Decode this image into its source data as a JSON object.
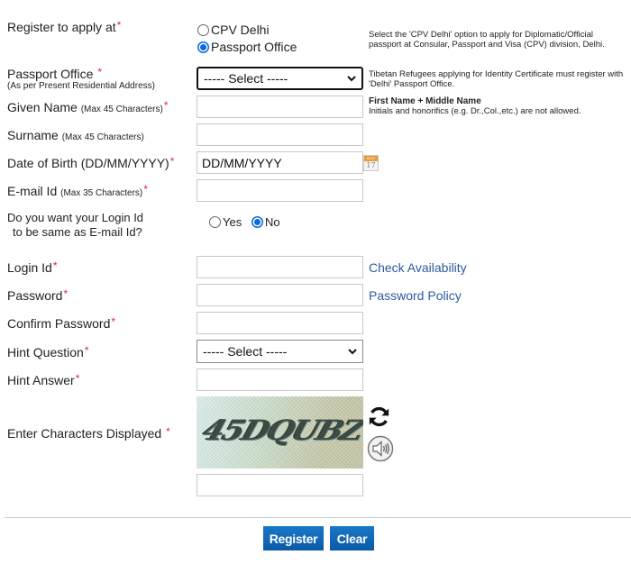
{
  "register_at": {
    "label": "Register to apply at",
    "options": [
      {
        "label": "CPV Delhi",
        "selected": false
      },
      {
        "label": "Passport Office",
        "selected": true
      }
    ],
    "hint": "Select the 'CPV Delhi' option to apply for Diplomatic/Official passport at Consular, Passport and Visa (CPV) division, Delhi."
  },
  "passport_office": {
    "label": "Passport Office",
    "sublabel": "(As per Present Residential Address)",
    "selected": "----- Select -----",
    "hint": "Tibetan Refugees applying for Identity Certificate must register with 'Delhi' Passport Office."
  },
  "given_name": {
    "label": "Given Name",
    "note": "(Max 45 Characters)",
    "value": "",
    "hint_title": "First Name + Middle Name",
    "hint": "Initials and honorifics (e.g. Dr.,Col.,etc.) are not allowed."
  },
  "surname": {
    "label": "Surname",
    "note": "(Max 45 Characters)",
    "value": ""
  },
  "dob": {
    "label": "Date of Birth (DD/MM/YYYY)",
    "value": "DD/MM/YYYY",
    "calendar_month": "NOV",
    "calendar_day": "17"
  },
  "email": {
    "label": "E-mail Id",
    "note": "(Max 35 Characters)",
    "value": ""
  },
  "login_same": {
    "label_line1": "Do you want your Login Id",
    "label_line2": "to be same as E-mail Id?",
    "options": [
      {
        "label": "Yes",
        "selected": false
      },
      {
        "label": "No",
        "selected": true
      }
    ]
  },
  "login_id": {
    "label": "Login Id",
    "value": "",
    "link": "Check Availability"
  },
  "password": {
    "label": "Password",
    "value": "",
    "link": "Password Policy"
  },
  "confirm_password": {
    "label": "Confirm Password",
    "value": ""
  },
  "hint_question": {
    "label": "Hint Question",
    "selected": "----- Select -----"
  },
  "hint_answer": {
    "label": "Hint Answer",
    "value": ""
  },
  "captcha": {
    "label": "Enter Characters Displayed",
    "image_text": "45DQUBZ",
    "value": ""
  },
  "required_mark": "*",
  "buttons": {
    "register": "Register",
    "clear": "Clear"
  },
  "colors": {
    "required": "#e0283a",
    "link": "#2c5aa0",
    "button": "#0a5aa6",
    "radio_selected": "#0b6bdc"
  }
}
